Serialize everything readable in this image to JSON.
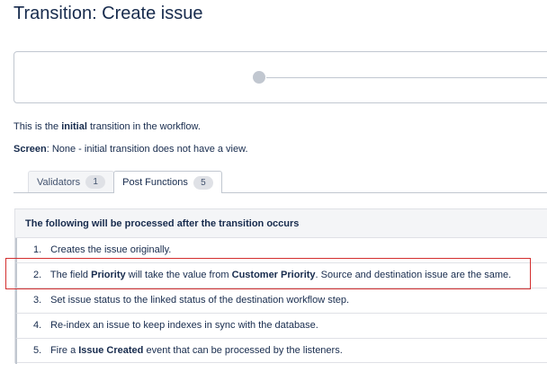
{
  "page": {
    "title": "Transition: Create issue"
  },
  "info": {
    "initial_prefix": "This is the ",
    "initial_bold": "initial",
    "initial_suffix": " transition in the workflow.",
    "screen_label": "Screen",
    "screen_value": ": None - initial transition does not have a view."
  },
  "tabs": [
    {
      "label": "Validators",
      "count": "1",
      "active": false
    },
    {
      "label": "Post Functions",
      "count": "5",
      "active": true
    }
  ],
  "panel": {
    "header": "The following will be processed after the transition occurs",
    "items": [
      {
        "num": "1.",
        "parts": [
          {
            "t": "Creates the issue originally."
          }
        ]
      },
      {
        "num": "2.",
        "parts": [
          {
            "t": "The field "
          },
          {
            "t": "Priority",
            "b": true
          },
          {
            "t": " will take the value from "
          },
          {
            "t": "Customer Priority",
            "b": true
          },
          {
            "t": ". Source and destination issue are the same."
          }
        ]
      },
      {
        "num": "3.",
        "parts": [
          {
            "t": "Set issue status to the linked status of the destination workflow step."
          }
        ]
      },
      {
        "num": "4.",
        "parts": [
          {
            "t": "Re-index an issue to keep indexes in sync with the database."
          }
        ]
      },
      {
        "num": "5.",
        "parts": [
          {
            "t": "Fire a "
          },
          {
            "t": "Issue Created",
            "b": true
          },
          {
            "t": " event that can be processed by the listeners."
          }
        ]
      }
    ]
  },
  "colors": {
    "highlight": "#d32f2f",
    "text": "#172b4d",
    "border": "#c1c7d0"
  }
}
